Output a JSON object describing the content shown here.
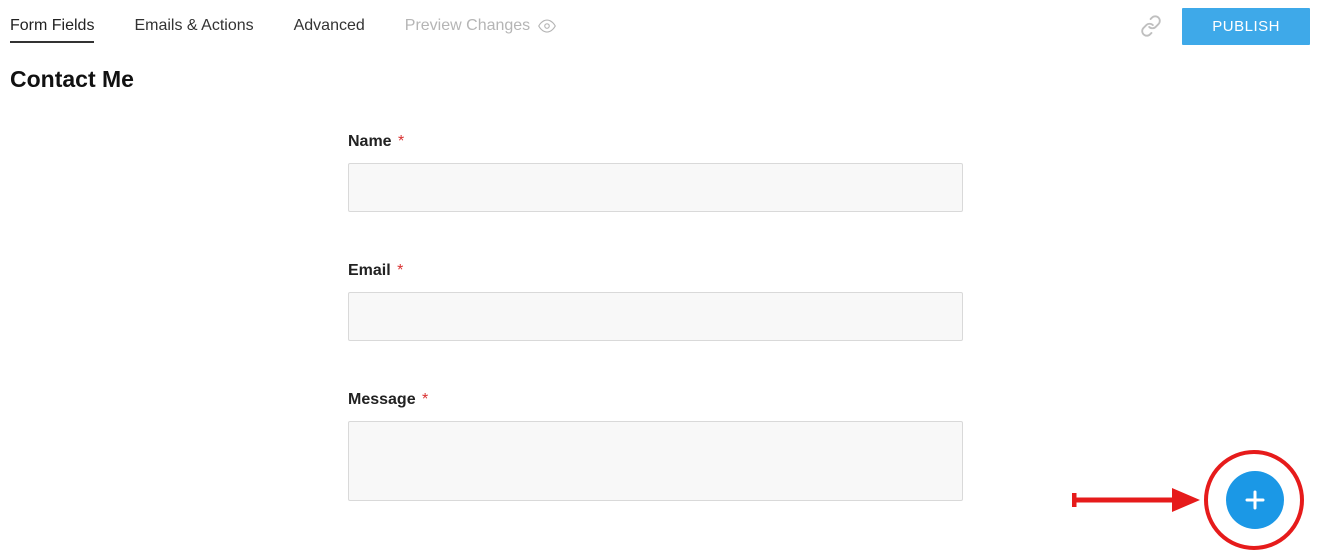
{
  "tabs": {
    "form_fields": "Form Fields",
    "emails_actions": "Emails & Actions",
    "advanced": "Advanced",
    "preview_changes": "Preview Changes"
  },
  "actions": {
    "publish": "PUBLISH"
  },
  "page_title": "Contact Me",
  "fields": {
    "name": {
      "label": "Name",
      "required": "*"
    },
    "email": {
      "label": "Email",
      "required": "*"
    },
    "message": {
      "label": "Message",
      "required": "*"
    }
  }
}
